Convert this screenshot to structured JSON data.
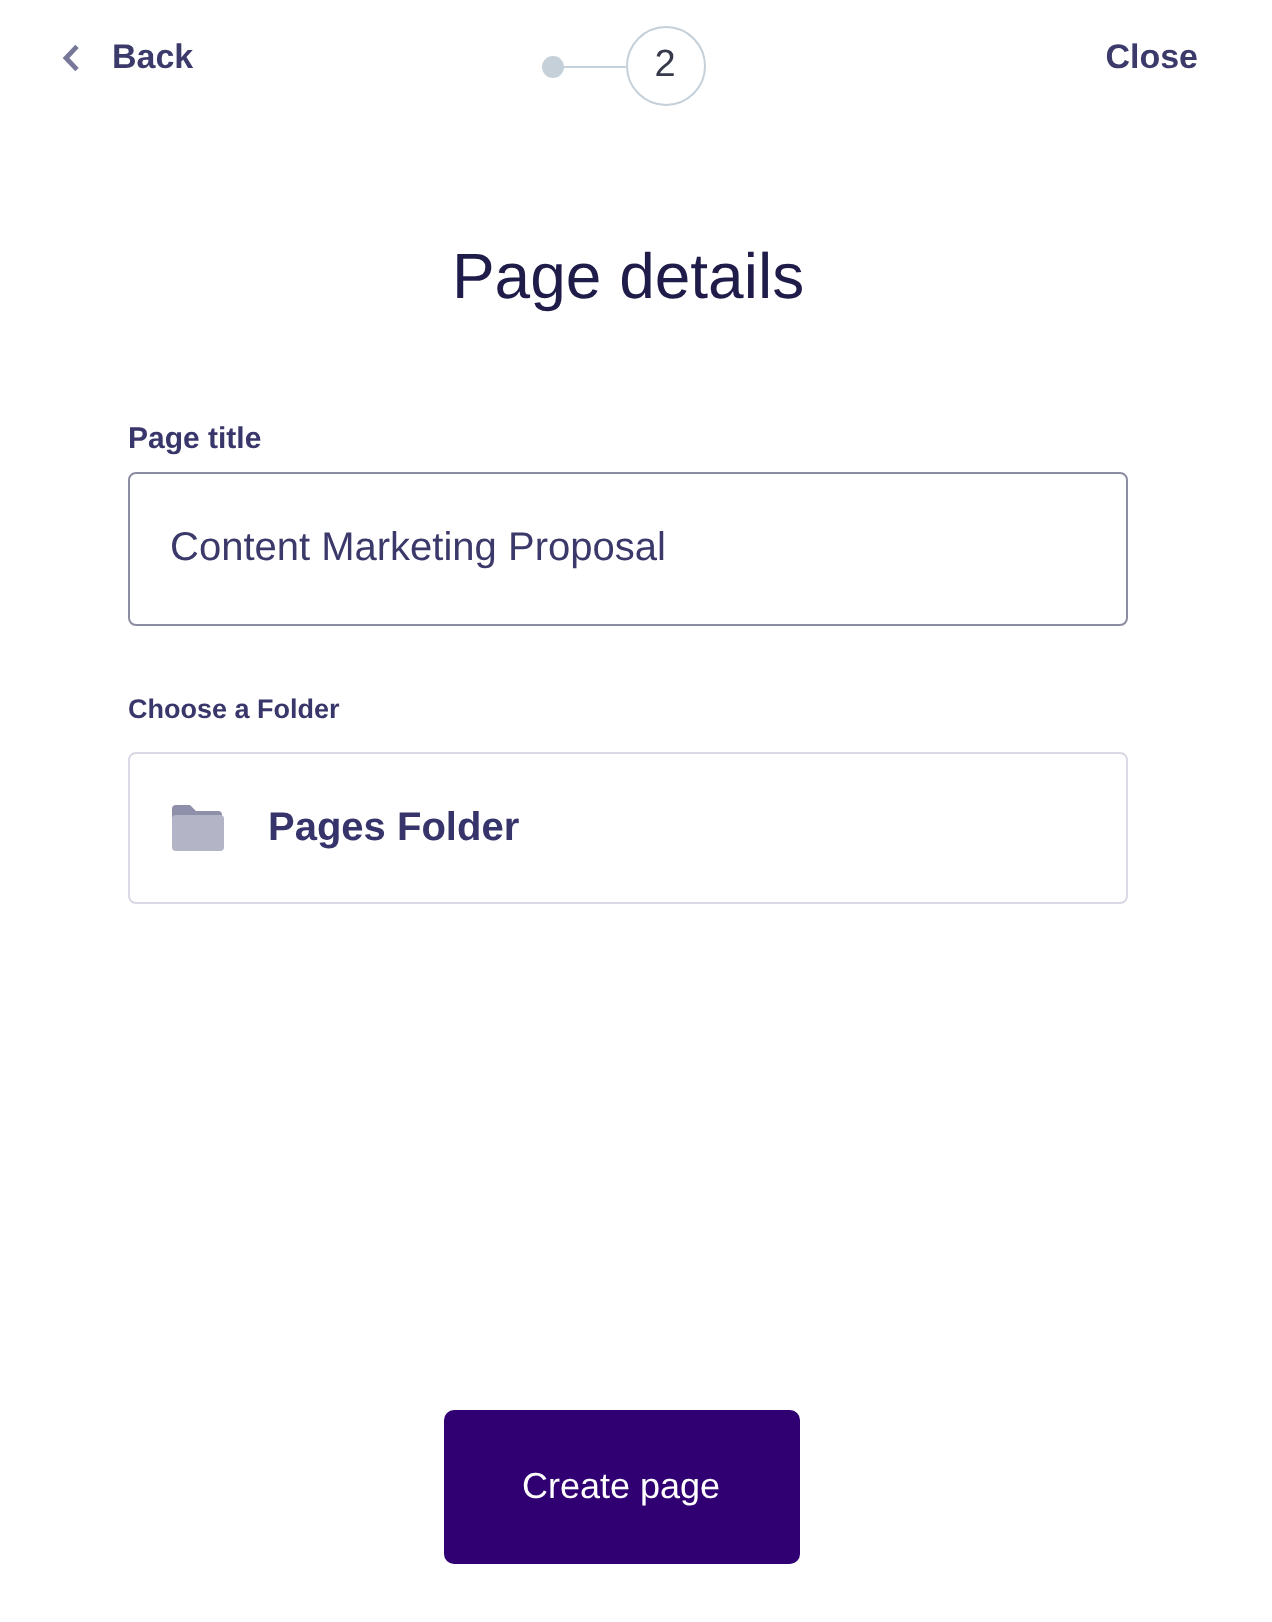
{
  "header": {
    "back": "Back",
    "close": "Close"
  },
  "stepper": {
    "steps": [
      {
        "selected": false
      },
      {
        "label": "2",
        "selected": true
      }
    ]
  },
  "title": "Page details",
  "fields": [
    {
      "kind": "text",
      "label": "Page title",
      "value": "Content Marketing Proposal"
    },
    {
      "kind": "folder",
      "label": "Choose a Folder",
      "value": "Pages Folder"
    }
  ],
  "submit": "Create page"
}
